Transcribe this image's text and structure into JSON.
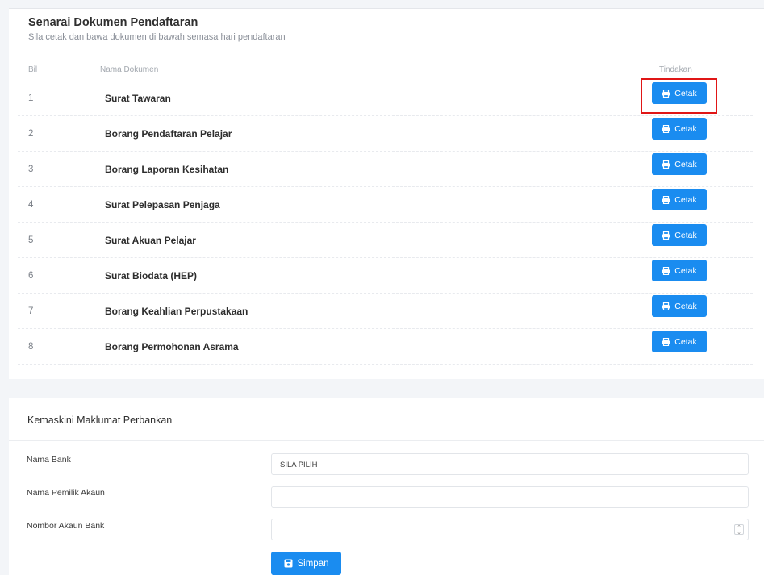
{
  "documents": {
    "title": "Senarai Dokumen Pendaftaran",
    "subtitle": "Sila cetak dan bawa dokumen di bawah semasa hari pendaftaran",
    "headers": {
      "bil": "Bil",
      "name": "Nama Dokumen",
      "action": "Tindakan"
    },
    "print_label": "Cetak",
    "rows": [
      {
        "no": "1",
        "name": "Surat Tawaran"
      },
      {
        "no": "2",
        "name": "Borang Pendaftaran Pelajar"
      },
      {
        "no": "3",
        "name": "Borang Laporan Kesihatan"
      },
      {
        "no": "4",
        "name": "Surat Pelepasan Penjaga"
      },
      {
        "no": "5",
        "name": "Surat Akuan Pelajar"
      },
      {
        "no": "6",
        "name": "Surat Biodata (HEP)"
      },
      {
        "no": "7",
        "name": "Borang Keahlian Perpustakaan"
      },
      {
        "no": "8",
        "name": "Borang Permohonan Asrama"
      }
    ]
  },
  "bank": {
    "title": "Kemaskini Maklumat Perbankan",
    "fields": {
      "bank_name_label": "Nama Bank",
      "bank_name_value": "SILA PILIH",
      "owner_label": "Nama Pemilik Akaun",
      "owner_value": "",
      "account_label": "Nombor Akaun Bank",
      "account_value": ""
    },
    "save_label": "Simpan"
  },
  "colors": {
    "primary": "#1a8cf0",
    "highlight": "#e01616"
  }
}
